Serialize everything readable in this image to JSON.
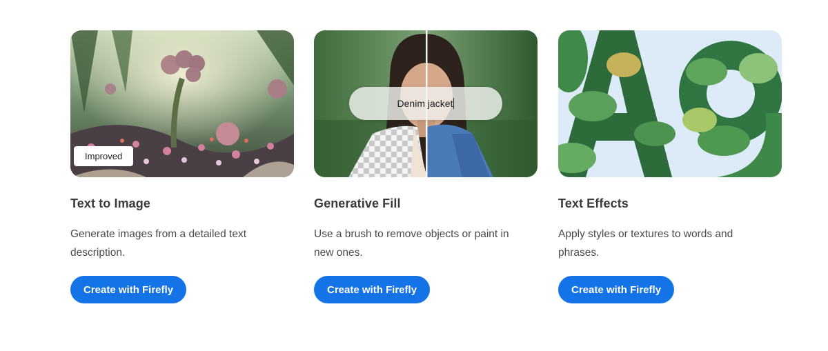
{
  "cards": [
    {
      "title": "Text to Image",
      "description": "Generate images from a detailed text description.",
      "badge": "Improved",
      "button_label": "Create with Firefly"
    },
    {
      "title": "Generative Fill",
      "description": "Use a brush to remove objects or paint in new ones.",
      "prompt_text": "Denim jacket",
      "button_label": "Create with Firefly"
    },
    {
      "title": "Text Effects",
      "description": "Apply styles or textures to words and phrases.",
      "button_label": "Create with Firefly"
    }
  ],
  "colors": {
    "accent": "#1473e6",
    "background": "#ffffff"
  }
}
